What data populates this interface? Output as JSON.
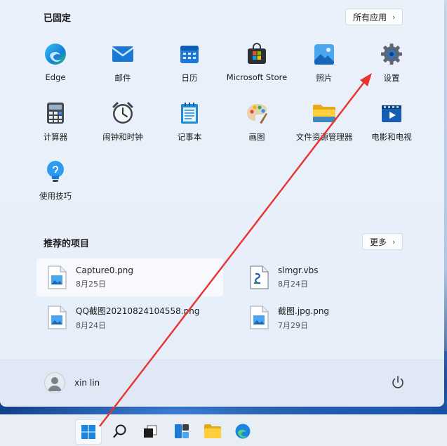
{
  "pinned": {
    "title": "已固定",
    "all_apps_label": "所有应用",
    "apps": [
      {
        "label": "Edge",
        "icon": "edge-icon"
      },
      {
        "label": "邮件",
        "icon": "mail-icon"
      },
      {
        "label": "日历",
        "icon": "calendar-icon"
      },
      {
        "label": "Microsoft Store",
        "icon": "store-icon"
      },
      {
        "label": "照片",
        "icon": "photos-icon"
      },
      {
        "label": "设置",
        "icon": "settings-icon"
      },
      {
        "label": "计算器",
        "icon": "calculator-icon"
      },
      {
        "label": "闹钟和时钟",
        "icon": "clock-icon"
      },
      {
        "label": "记事本",
        "icon": "notepad-icon"
      },
      {
        "label": "画图",
        "icon": "paint-icon"
      },
      {
        "label": "文件资源管理器",
        "icon": "folder-icon"
      },
      {
        "label": "电影和电视",
        "icon": "movies-icon"
      },
      {
        "label": "使用技巧",
        "icon": "tips-icon"
      }
    ]
  },
  "recommended": {
    "title": "推荐的项目",
    "more_label": "更多",
    "items": [
      {
        "name": "Capture0.png",
        "date": "8月25日",
        "icon": "image-file-icon"
      },
      {
        "name": "slmgr.vbs",
        "date": "8月24日",
        "icon": "script-file-icon"
      },
      {
        "name": "QQ截图20210824104558.png",
        "date": "8月24日",
        "icon": "image-file-icon"
      },
      {
        "name": "截图.jpg.png",
        "date": "7月29日",
        "icon": "image-file-icon"
      }
    ]
  },
  "user": {
    "name": "xin lin"
  },
  "taskbar": {
    "items": [
      "start-icon",
      "search-icon",
      "task-view-icon",
      "widgets-icon",
      "file-explorer-icon",
      "edge-icon"
    ]
  },
  "colors": {
    "annotation_arrow": "#e8332e",
    "accent": "#0067c0"
  }
}
